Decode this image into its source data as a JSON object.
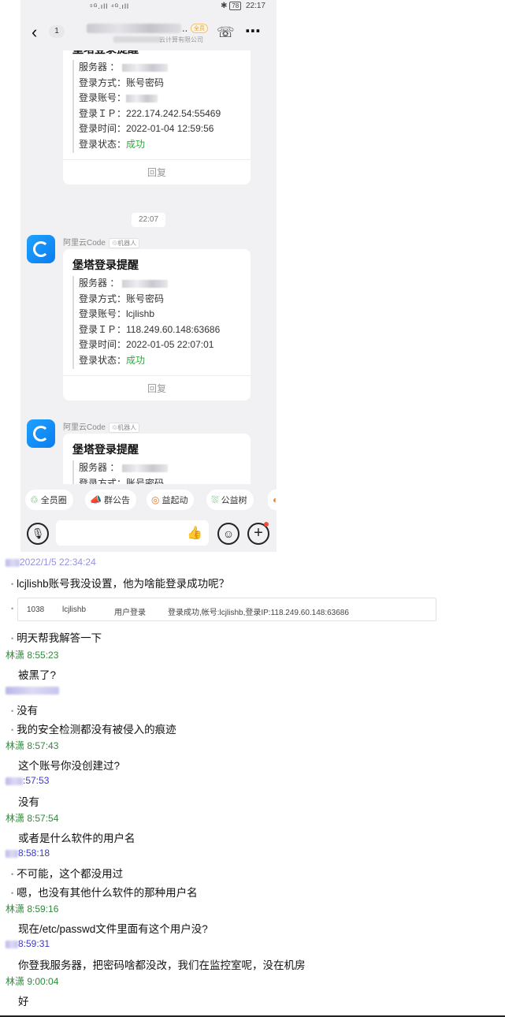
{
  "status_bar": {
    "signal": "⁵ᴳ.ıll ⁴ᴳ.ıll",
    "battery": "78",
    "time": "22:17"
  },
  "nav": {
    "back": "‹",
    "unread": "1",
    "title_suffix": "..",
    "tag": "全员",
    "subtitle": "云计算有限公司"
  },
  "card_prev": {
    "title": "堡塔登录提醒",
    "rows": [
      {
        "label": "服务器   ：",
        "value": ""
      },
      {
        "label": "登录方式：",
        "value": "账号密码"
      },
      {
        "label": "登录账号：",
        "value": ""
      },
      {
        "label": "登录ＩＰ：",
        "value": "222.174.242.54:55469"
      },
      {
        "label": "登录时间：",
        "value": "2022-01-04 12:59:56"
      },
      {
        "label": "登录状态：",
        "value": "成功"
      }
    ],
    "reply": "回复"
  },
  "time_pill": "22:07",
  "bot": {
    "name": "阿里云Code",
    "tag": "♲机器人"
  },
  "card_main": {
    "title": "堡塔登录提醒",
    "rows": [
      {
        "label": "服务器   ：",
        "value": ""
      },
      {
        "label": "登录方式：",
        "value": "账号密码"
      },
      {
        "label": "登录账号：",
        "value": "lcjlishb"
      },
      {
        "label": "登录ＩＰ：",
        "value": "118.249.60.148:63686"
      },
      {
        "label": "登录时间：",
        "value": "2022-01-05 22:07:01"
      },
      {
        "label": "登录状态：",
        "value": "成功"
      }
    ],
    "reply": "回复"
  },
  "card_next": {
    "title": "堡塔登录提醒",
    "rows": [
      {
        "label": "服务器   ：",
        "value": ""
      },
      {
        "label": "登录方式：",
        "value": "账号密码"
      }
    ]
  },
  "quick_actions": [
    {
      "icon": "♲",
      "label": "全员圈"
    },
    {
      "icon": "📣",
      "label": "群公告"
    },
    {
      "icon": "◎",
      "label": "益起动"
    },
    {
      "icon": "⛆",
      "label": "公益树"
    }
  ],
  "colors": {
    "success": "#2eaa3c",
    "me_name": "#2f8a3a",
    "other_name": "#3a39c8",
    "bot_blue": "#0a7df0"
  },
  "log": {
    "h1_time": "2022/1/5 22:34:24",
    "m1": "lcjlishb账号我没设置，他为啥能登录成功呢？",
    "logline": {
      "id": "1038",
      "user": "lcjlishb",
      "type": "用户登录",
      "detail": "登录成功,帐号:lcjlishb,登录IP:118.249.60.148:63686"
    },
    "m2": "明天帮我解答一下",
    "h2": "林潇  8:55:23",
    "m3": "被黑了?",
    "m4": "没有",
    "m5": "我的安全检测都没有被侵入的痕迹",
    "h4": "林潇  8:57:43",
    "m6": "这个账号你没创建过?",
    "h5_time": ":57:53",
    "m7": "没有",
    "h6": "林潇  8:57:54",
    "m8": "或者是什么软件的用户名",
    "h7_time": "8:58:18",
    "m9": "不可能，这个都没用过",
    "m10": "嗯，也没有其他什么软件的那种用户名",
    "h8": "林潇  8:59:16",
    "m11": "现在/etc/passwd文件里面有这个用户没?",
    "h9_time": "8:59:31",
    "m12": "你登我服务器，把密码啥都没改，我们在监控室呢，没在机房",
    "h10": "林潇  9:00:04",
    "m13": "好"
  }
}
